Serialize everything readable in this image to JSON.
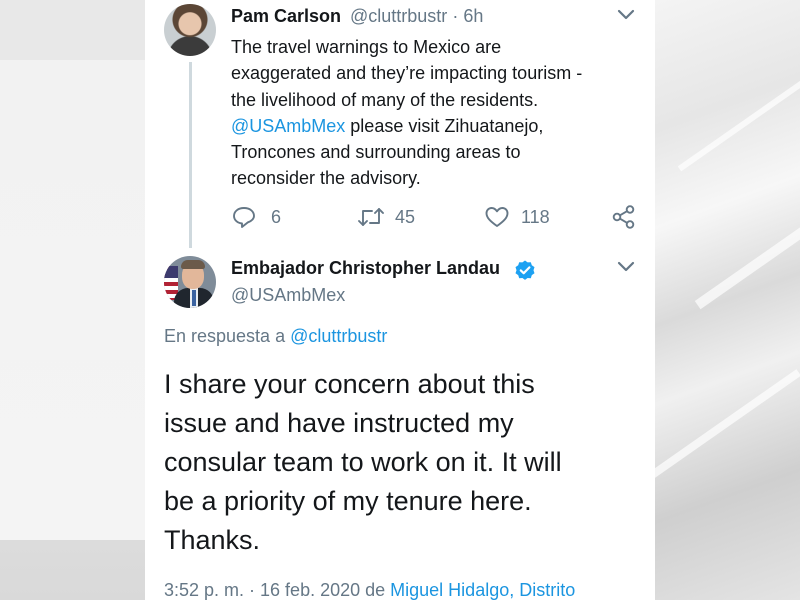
{
  "tweet1": {
    "name": "Pam Carlson",
    "handle": "@cluttrbustr",
    "sep": "·",
    "time": "6h",
    "text_line1": "The travel warnings to Mexico are",
    "text_line2": "exaggerated and they’re impacting tourism -",
    "text_line3": "the livelihood of many of the residents.",
    "mention": "@USAmbMex",
    "text_line4_rest": " please visit Zihuatanejo,",
    "text_line5": "Troncones and surrounding areas to",
    "text_line6": "reconsider the advisory.",
    "replies": "6",
    "retweets": "45",
    "likes": "118",
    "icons": [
      "reply-icon",
      "retweet-icon",
      "like-icon",
      "share-icon",
      "chevron-down-icon"
    ]
  },
  "tweet2": {
    "name": "Embajador Christopher Landau",
    "handle": "@USAmbMex",
    "reply_prefix": "En respuesta a ",
    "reply_mention": "@cluttrbustr",
    "text_line1": "I share your concern about this",
    "text_line2": "issue and have instructed my",
    "text_line3": "consular team to work on it. It will",
    "text_line4": "be a priority of my tenure here.",
    "text_line5": "Thanks.",
    "timestamp": "3:52 p. m. · 16 feb. 2020 de ",
    "location": "Miguel Hidalgo, Distrito",
    "icons": [
      "verified-badge-icon",
      "chevron-down-icon"
    ]
  },
  "colors": {
    "text": "#14171a",
    "secondary": "#657786",
    "link": "#1b95e0",
    "verified": "#1da1f2",
    "background": "#ffffff"
  }
}
